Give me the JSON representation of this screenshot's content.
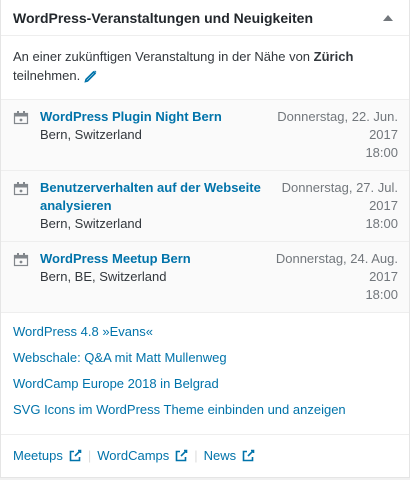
{
  "widget": {
    "title": "WordPress-Veranstaltungen und Neuigkeiten",
    "toggle_icon": "triangle-up-icon"
  },
  "location": {
    "prefix": "An einer zukünftigen Veranstaltung in der Nähe von ",
    "city": "Zürich",
    "suffix": " teilnehmen.",
    "edit_icon": "pencil-icon"
  },
  "events": [
    {
      "title": "WordPress Plugin Night Bern",
      "location": "Bern, Switzerland",
      "date": "Donnerstag, 22. Jun. 2017",
      "time": "18:00"
    },
    {
      "title": "Benutzerverhalten auf der Webseite analysieren",
      "location": "Bern, Switzerland",
      "date": "Donnerstag, 27. Jul. 2017",
      "time": "18:00"
    },
    {
      "title": "WordPress Meetup Bern",
      "location": "Bern, BE, Switzerland",
      "date": "Donnerstag, 24. Aug. 2017",
      "time": "18:00"
    }
  ],
  "news": [
    "WordPress 4.8 »Evans«",
    "Webschale: Q&A mit Matt Mullenweg",
    "WordCamp Europe 2018 in Belgrad",
    "SVG Icons im WordPress Theme einbinden und anzeigen"
  ],
  "footer": {
    "links": [
      "Meetups",
      "WordCamps",
      "News"
    ],
    "separator": "|",
    "link_icon": "external-link-icon"
  },
  "colors": {
    "link": "#0073aa",
    "text": "#32373c",
    "muted": "#72777c",
    "border": "#eeeeee"
  }
}
